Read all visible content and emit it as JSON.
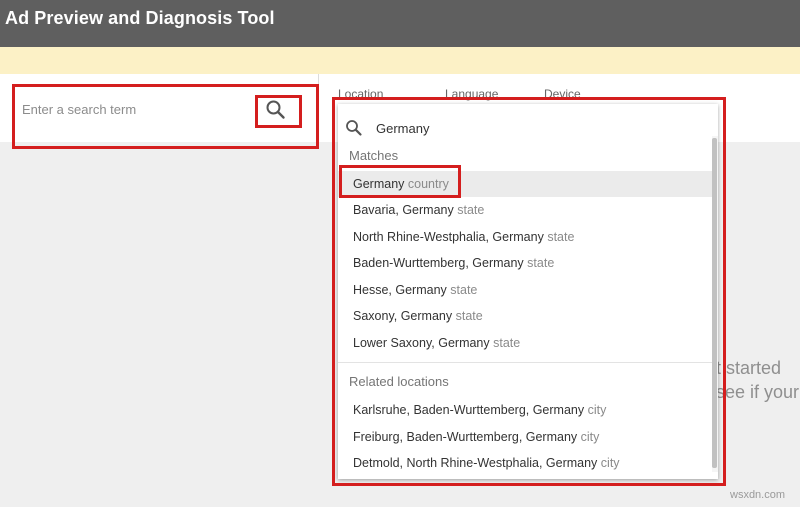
{
  "app": {
    "title": "Ad Preview and Diagnosis Tool"
  },
  "search": {
    "placeholder": "Enter a search term",
    "icon": "search-icon"
  },
  "filters": {
    "tabs": [
      "Location",
      "Language",
      "Device"
    ]
  },
  "location_dropdown": {
    "query": "Germany",
    "matches_header": "Matches",
    "matches": [
      {
        "name": "Germany",
        "type": "country"
      },
      {
        "name": "Bavaria, Germany",
        "type": "state"
      },
      {
        "name": "North Rhine-Westphalia, Germany",
        "type": "state"
      },
      {
        "name": "Baden-Wurttemberg, Germany",
        "type": "state"
      },
      {
        "name": "Hesse, Germany",
        "type": "state"
      },
      {
        "name": "Saxony, Germany",
        "type": "state"
      },
      {
        "name": "Lower Saxony, Germany",
        "type": "state"
      }
    ],
    "related_header": "Related locations",
    "related": [
      {
        "name": "Karlsruhe, Baden-Wurttemberg, Germany",
        "type": "city"
      },
      {
        "name": "Freiburg, Baden-Wurttemberg, Germany",
        "type": "city"
      },
      {
        "name": "Detmold, North Rhine-Westphalia, Germany",
        "type": "city"
      }
    ]
  },
  "background_text": {
    "line1": "t started",
    "line2": "see if your"
  },
  "watermark": "wsxdn.com",
  "colors": {
    "topbar": "#5f5f5f",
    "banner": "#fcf1c6",
    "highlight_box": "#d41e1e",
    "background": "#efefef"
  }
}
